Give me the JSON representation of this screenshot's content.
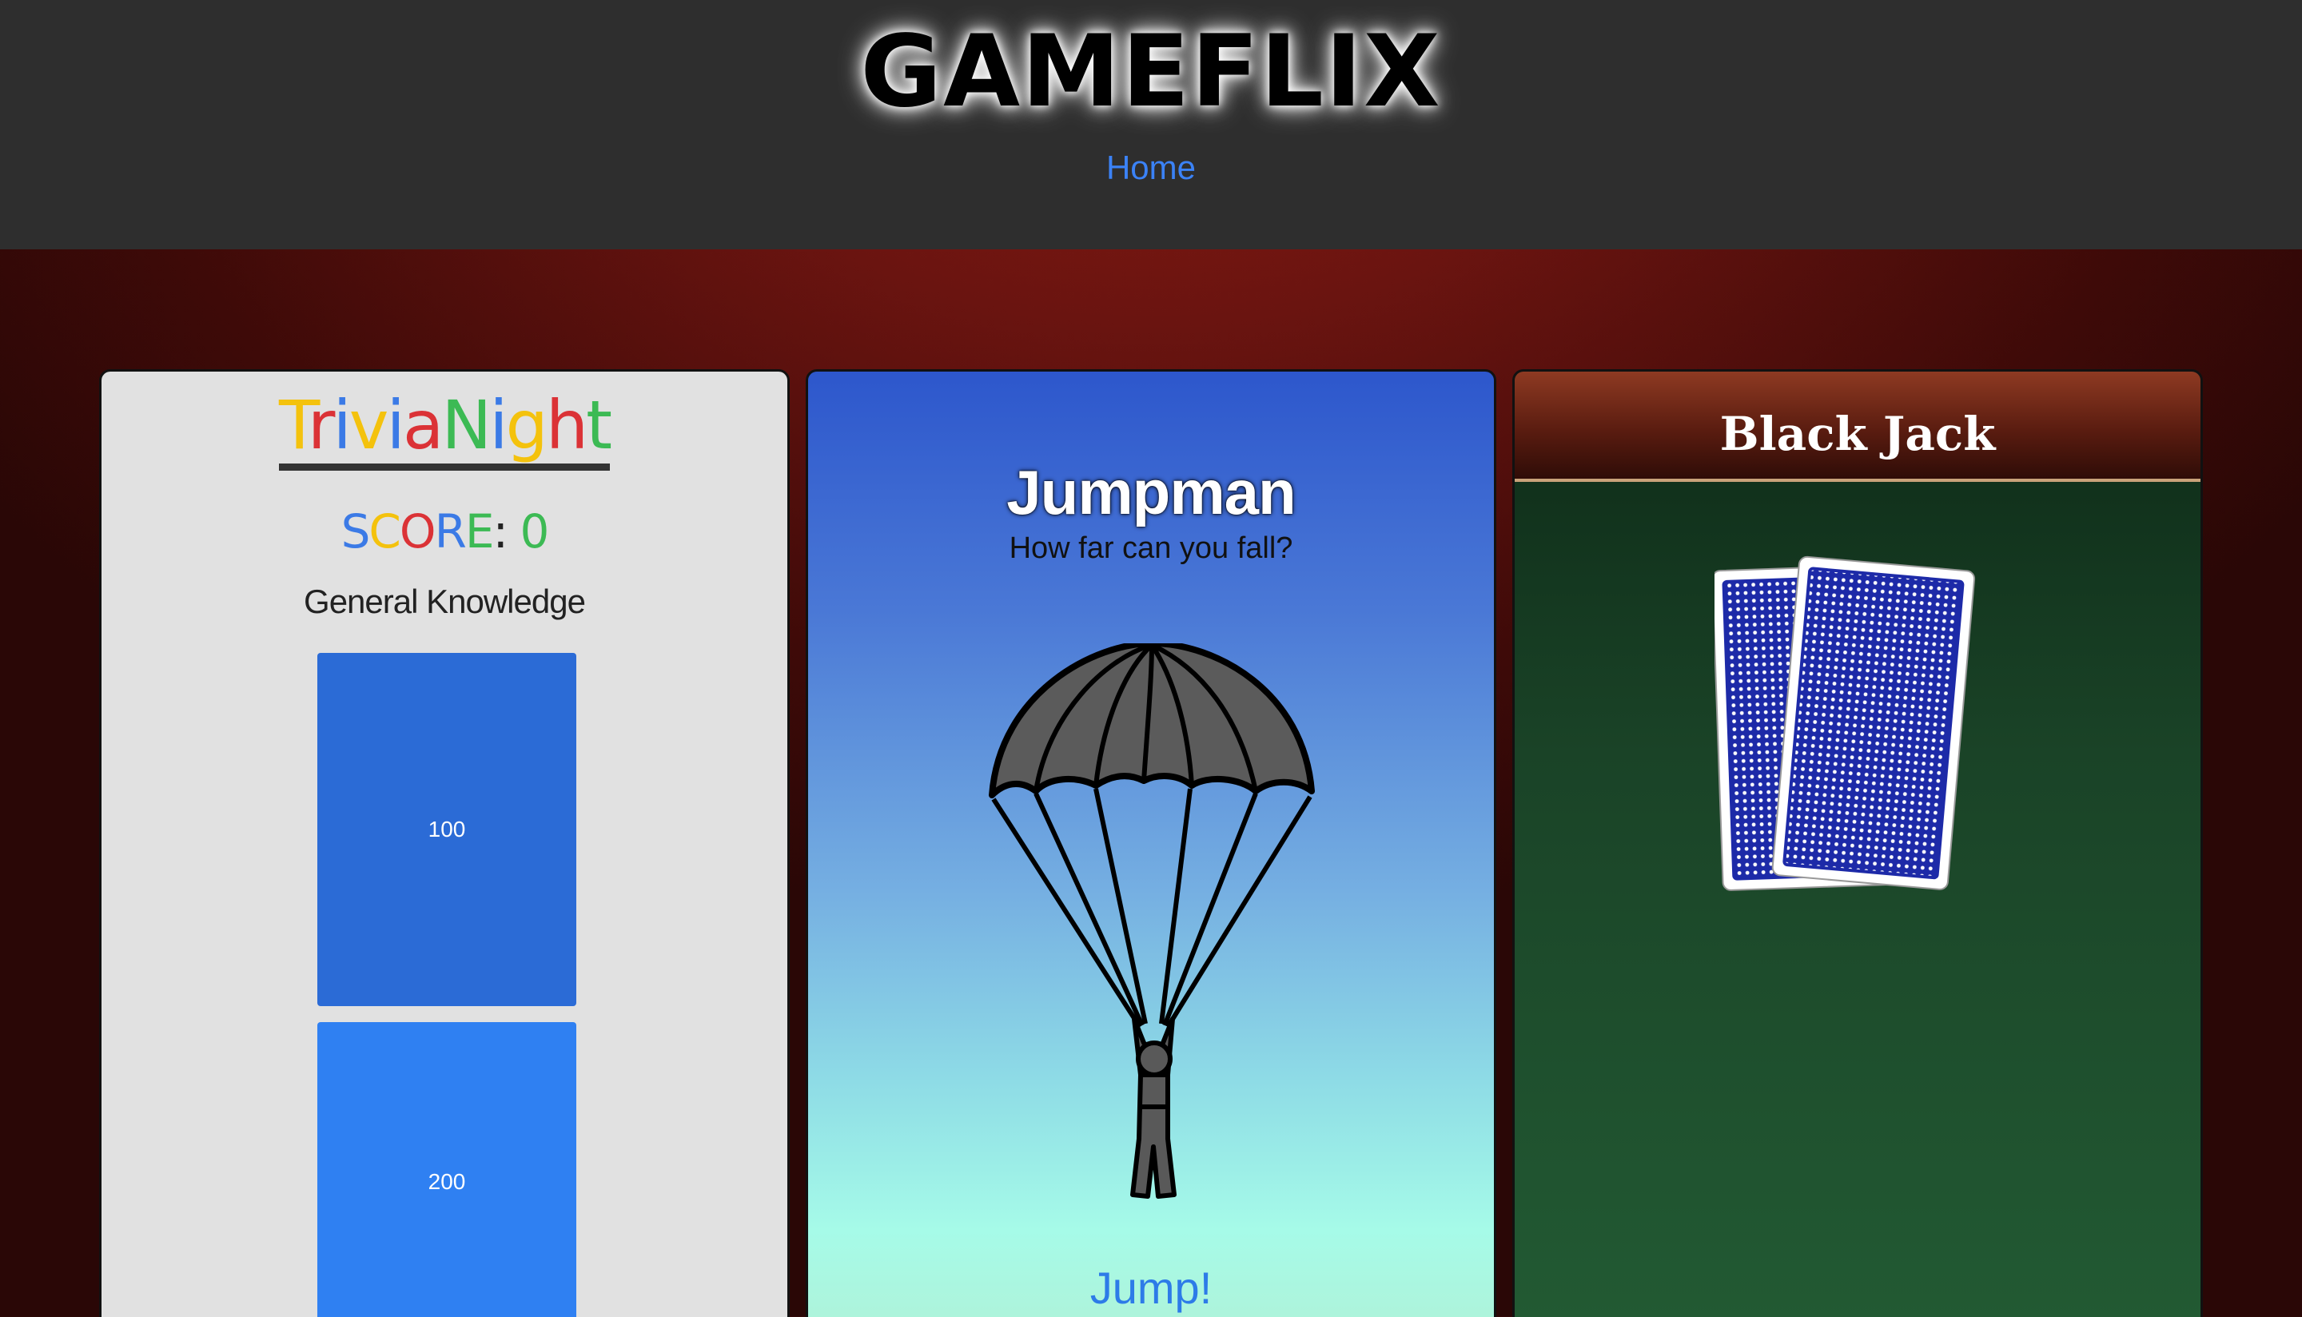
{
  "header": {
    "brand": "GAMEFLIX",
    "nav": {
      "home": "Home"
    }
  },
  "trivia": {
    "logo_letters": [
      {
        "ch": "T",
        "color": "#f4c20d"
      },
      {
        "ch": "r",
        "color": "#db3236"
      },
      {
        "ch": "i",
        "color": "#3b7ae6"
      },
      {
        "ch": "v",
        "color": "#f4c20d"
      },
      {
        "ch": "i",
        "color": "#3b7ae6"
      },
      {
        "ch": "a",
        "color": "#db3236"
      },
      {
        "ch": "N",
        "color": "#3cba54"
      },
      {
        "ch": "i",
        "color": "#3b7ae6"
      },
      {
        "ch": "g",
        "color": "#f4c20d"
      },
      {
        "ch": "h",
        "color": "#db3236"
      },
      {
        "ch": "t",
        "color": "#3cba54"
      }
    ],
    "score_letters": [
      {
        "ch": "S",
        "color": "#3b7ae6"
      },
      {
        "ch": "C",
        "color": "#f4c20d"
      },
      {
        "ch": "O",
        "color": "#db3236"
      },
      {
        "ch": "R",
        "color": "#3b7ae6"
      },
      {
        "ch": "E",
        "color": "#3cba54"
      }
    ],
    "score_sep": ":",
    "score_value": "0",
    "category": "General Knowledge",
    "questions": [
      "100",
      "200"
    ]
  },
  "jumpman": {
    "title": "Jumpman",
    "subtitle": "How far can you fall?",
    "button": "Jump!",
    "icon": "parachute-icon"
  },
  "blackjack": {
    "title": "Black Jack",
    "icon": "card-deck-icon",
    "card_color": "#1d2aa8"
  },
  "colors": {
    "topbar": "#2e2e2e",
    "nav_link": "#3b82f6",
    "trivia_bg": "#e1e1e1",
    "qbox_1": "#2b6bd6",
    "qbox_2": "#2f80f2",
    "jump_button": "#2d7be8"
  }
}
